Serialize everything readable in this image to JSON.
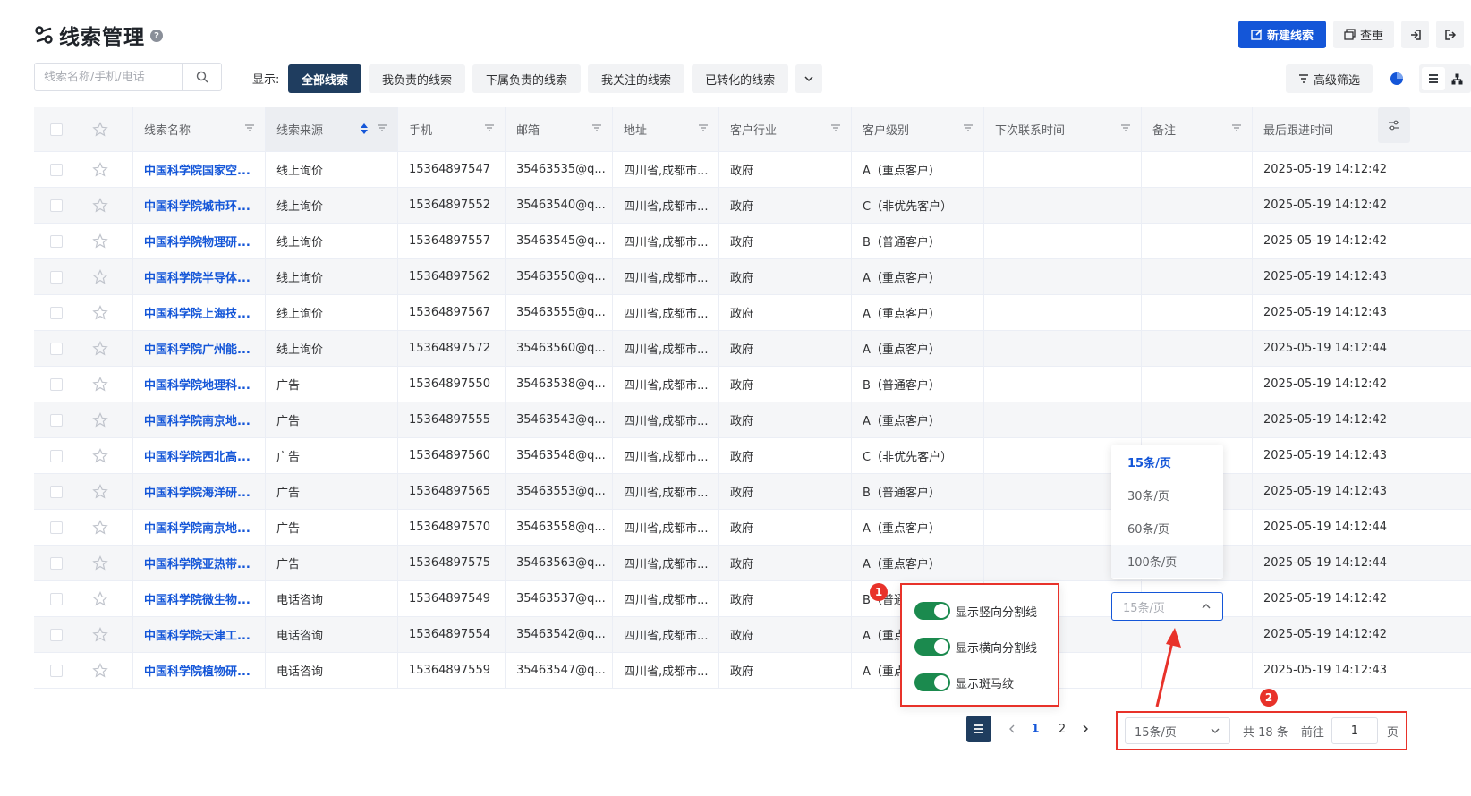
{
  "header": {
    "title": "线索管理",
    "help": "?",
    "new_button": "新建线索",
    "dedupe_button": "查重"
  },
  "search": {
    "placeholder": "线索名称/手机/电话",
    "value": ""
  },
  "filter": {
    "show_label": "显示:",
    "tabs": [
      "全部线索",
      "我负责的线索",
      "下属负责的线索",
      "我关注的线索",
      "已转化的线索"
    ],
    "active_tab": "全部线索",
    "advanced_button": "高级筛选"
  },
  "table": {
    "columns": [
      "线索名称",
      "线索来源",
      "手机",
      "邮箱",
      "地址",
      "客户行业",
      "客户级别",
      "下次联系时间",
      "备注",
      "最后跟进时间"
    ],
    "rows": [
      [
        "中国科学院国家空...",
        "线上询价",
        "15364897547",
        "35463535@q...",
        "四川省,成都市...",
        "政府",
        "A（重点客户）",
        "",
        "",
        "2025-05-19 14:12:42"
      ],
      [
        "中国科学院城市环...",
        "线上询价",
        "15364897552",
        "35463540@q...",
        "四川省,成都市...",
        "政府",
        "C（非优先客户）",
        "",
        "",
        "2025-05-19 14:12:42"
      ],
      [
        "中国科学院物理研...",
        "线上询价",
        "15364897557",
        "35463545@q...",
        "四川省,成都市...",
        "政府",
        "B（普通客户）",
        "",
        "",
        "2025-05-19 14:12:42"
      ],
      [
        "中国科学院半导体...",
        "线上询价",
        "15364897562",
        "35463550@q...",
        "四川省,成都市...",
        "政府",
        "A（重点客户）",
        "",
        "",
        "2025-05-19 14:12:43"
      ],
      [
        "中国科学院上海技...",
        "线上询价",
        "15364897567",
        "35463555@q...",
        "四川省,成都市...",
        "政府",
        "A（重点客户）",
        "",
        "",
        "2025-05-19 14:12:43"
      ],
      [
        "中国科学院广州能...",
        "线上询价",
        "15364897572",
        "35463560@q...",
        "四川省,成都市...",
        "政府",
        "A（重点客户）",
        "",
        "",
        "2025-05-19 14:12:44"
      ],
      [
        "中国科学院地理科...",
        "广告",
        "15364897550",
        "35463538@q...",
        "四川省,成都市...",
        "政府",
        "B（普通客户）",
        "",
        "",
        "2025-05-19 14:12:42"
      ],
      [
        "中国科学院南京地...",
        "广告",
        "15364897555",
        "35463543@q...",
        "四川省,成都市...",
        "政府",
        "A（重点客户）",
        "",
        "",
        "2025-05-19 14:12:42"
      ],
      [
        "中国科学院西北高...",
        "广告",
        "15364897560",
        "35463548@q...",
        "四川省,成都市...",
        "政府",
        "C（非优先客户）",
        "",
        "",
        "2025-05-19 14:12:43"
      ],
      [
        "中国科学院海洋研...",
        "广告",
        "15364897565",
        "35463553@q...",
        "四川省,成都市...",
        "政府",
        "B（普通客户）",
        "",
        "",
        "2025-05-19 14:12:43"
      ],
      [
        "中国科学院南京地...",
        "广告",
        "15364897570",
        "35463558@q...",
        "四川省,成都市...",
        "政府",
        "A（重点客户）",
        "",
        "",
        "2025-05-19 14:12:44"
      ],
      [
        "中国科学院亚热带...",
        "广告",
        "15364897575",
        "35463563@q...",
        "四川省,成都市...",
        "政府",
        "A（重点客户）",
        "",
        "",
        "2025-05-19 14:12:44"
      ],
      [
        "中国科学院微生物...",
        "电话咨询",
        "15364897549",
        "35463537@q...",
        "四川省,成都市...",
        "政府",
        "B（普通客户）",
        "",
        "",
        "2025-05-19 14:12:42"
      ],
      [
        "中国科学院天津工...",
        "电话咨询",
        "15364897554",
        "35463542@q...",
        "四川省,成都市...",
        "政府",
        "A（重点",
        "",
        "",
        "2025-05-19 14:12:42"
      ],
      [
        "中国科学院植物研...",
        "电话咨询",
        "15364897559",
        "35463547@q...",
        "四川省,成都市...",
        "政府",
        "A（重点",
        "",
        "",
        "2025-05-19 14:12:43"
      ]
    ]
  },
  "settings_popover": {
    "badge": "1",
    "items": [
      "显示竖向分割线",
      "显示横向分割线",
      "显示斑马纹"
    ]
  },
  "page_size_dropdown": {
    "options": [
      "15条/页",
      "30条/页",
      "60条/页",
      "100条/页"
    ],
    "selected": "15条/页",
    "trigger_value": "15条/页"
  },
  "pagination": {
    "badge": "2",
    "pages": [
      "1",
      "2"
    ],
    "current_page": "1",
    "page_size": "15条/页",
    "total": "共 18 条",
    "goto_label": "前往",
    "goto_value": "1",
    "page_suffix": "页"
  },
  "colors": {
    "primary": "#1456d8",
    "active_tab": "#1f3d5f",
    "switch_on": "#1b8a4e",
    "highlight": "#e8322a"
  }
}
